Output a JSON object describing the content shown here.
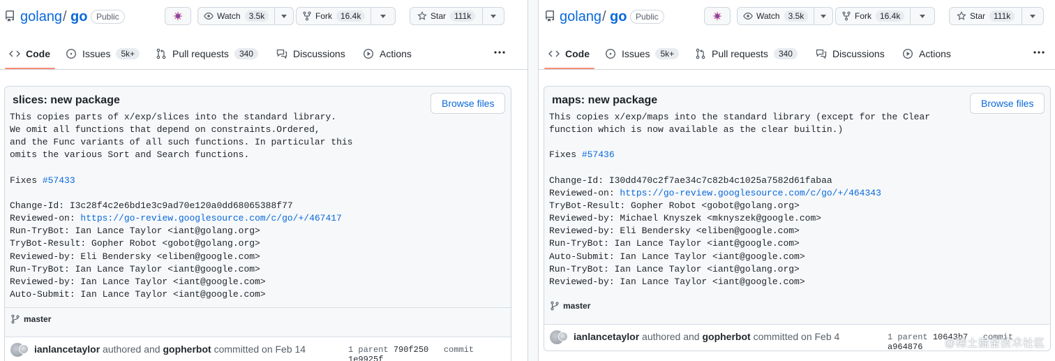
{
  "left": {
    "repo": {
      "owner": "golang",
      "name": "go",
      "visibility": "Public"
    },
    "header_buttons": {
      "watch_label": "Watch",
      "watch_count": "3.5k",
      "fork_label": "Fork",
      "fork_count": "16.4k",
      "star_label": "Star",
      "star_count": "111k"
    },
    "tabs": {
      "code": "Code",
      "issues": "Issues",
      "issues_count": "5k+",
      "pulls": "Pull requests",
      "pulls_count": "340",
      "discussions": "Discussions",
      "actions": "Actions"
    },
    "commit": {
      "title": "slices: new package",
      "browse_label": "Browse files",
      "lines": [
        "This copies parts of x/exp/slices into the standard library.",
        "We omit all functions that depend on constraints.Ordered,",
        "and the Func variants of all such functions. In particular this",
        "omits the various Sort and Search functions.",
        "",
        "Fixes ",
        "",
        "Change-Id: I3c28f4c2e6bd1e3c9ad70e120a0dd68065388f77",
        "Reviewed-on: ",
        "Run-TryBot: Ian Lance Taylor <iant@golang.org>",
        "TryBot-Result: Gopher Robot <gobot@golang.org>",
        "Reviewed-by: Eli Bendersky <eliben@google.com>",
        "Run-TryBot: Ian Lance Taylor <iant@google.com>",
        "Reviewed-by: Ian Lance Taylor <iant@google.com>",
        "Auto-Submit: Ian Lance Taylor <iant@google.com>"
      ],
      "fixes_link": "#57433",
      "review_link": "https://go-review.googlesource.com/c/go/+/467417",
      "branch": "master",
      "author": "ianlancetaylor",
      "authored_text": "authored and",
      "committer": "gopherbot",
      "committed_text": "committed on Feb 14",
      "parent_label": "1 parent",
      "parent_sha": "790f250",
      "commit_label": "commit",
      "commit_sha": "1e9925f"
    }
  },
  "right": {
    "repo": {
      "owner": "golang",
      "name": "go",
      "visibility": "Public"
    },
    "header_buttons": {
      "watch_label": "Watch",
      "watch_count": "3.5k",
      "fork_label": "Fork",
      "fork_count": "16.4k",
      "star_label": "Star",
      "star_count": "111k"
    },
    "tabs": {
      "code": "Code",
      "issues": "Issues",
      "issues_count": "5k+",
      "pulls": "Pull requests",
      "pulls_count": "340",
      "discussions": "Discussions",
      "actions": "Actions"
    },
    "commit": {
      "title": "maps: new package",
      "browse_label": "Browse files",
      "lines": [
        "This copies x/exp/maps into the standard library (except for the Clear",
        "function which is now available as the clear builtin.)",
        "",
        "Fixes ",
        "",
        "Change-Id: I30dd470c2f7ae34c7c82b4c1025a7582d61fabaa",
        "Reviewed-on: ",
        "TryBot-Result: Gopher Robot <gobot@golang.org>",
        "Reviewed-by: Michael Knyszek <mknyszek@google.com>",
        "Reviewed-by: Eli Bendersky <eliben@google.com>",
        "Run-TryBot: Ian Lance Taylor <iant@google.com>",
        "Auto-Submit: Ian Lance Taylor <iant@google.com>",
        "Run-TryBot: Ian Lance Taylor <iant@golang.org>",
        "Reviewed-by: Ian Lance Taylor <iant@google.com>"
      ],
      "fixes_link": "#57436",
      "review_link": "https://go-review.googlesource.com/c/go/+/464343",
      "branch": "master",
      "author": "ianlancetaylor",
      "authored_text": "authored and",
      "committer": "gopherbot",
      "committed_text": "committed on Feb 4",
      "parent_label": "1 parent",
      "parent_sha": "10643b7",
      "commit_label": "commit",
      "commit_sha": "a964876"
    }
  },
  "watermark": "@稀土掘金技术社区"
}
